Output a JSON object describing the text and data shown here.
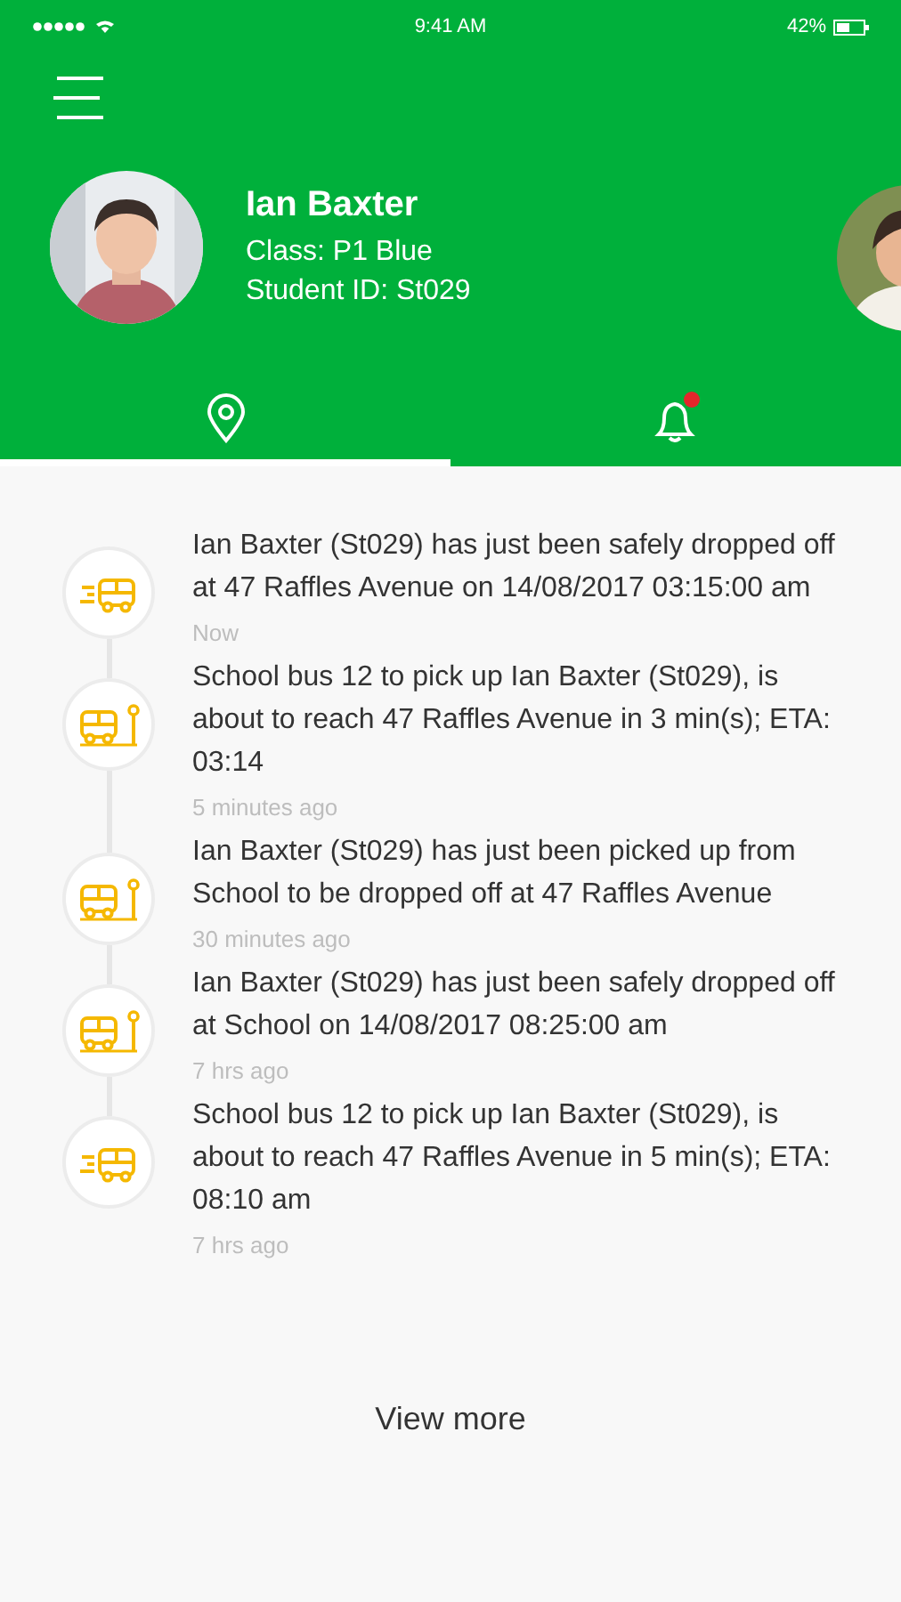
{
  "status_bar": {
    "time": "9:41 AM",
    "battery": "42%"
  },
  "student": {
    "name": "Ian Baxter",
    "class": "Class: P1 Blue",
    "student_id": "Student ID: St029"
  },
  "tabs": [
    {
      "selected": true,
      "alert": false
    },
    {
      "selected": false,
      "alert": true
    }
  ],
  "events": [
    {
      "kind": "moving",
      "message": "Ian Baxter (St029) has just been safely dropped off at 47 Raffles Avenue on 14/08/2017 03:15:00 am",
      "time": "Now"
    },
    {
      "kind": "stop",
      "message": "School bus 12 to pick up Ian Baxter (St029), is about to reach 47 Raffles Avenue in 3 min(s); ETA: 03:14",
      "time": "5 minutes ago"
    },
    {
      "kind": "stop",
      "message": "Ian Baxter (St029) has just been picked up from School to be dropped off at 47 Raffles Avenue",
      "time": "30 minutes ago"
    },
    {
      "kind": "stop",
      "message": "Ian Baxter (St029) has just been safely dropped off at School on 14/08/2017 08:25:00 am",
      "time": "7 hrs ago"
    },
    {
      "kind": "moving",
      "message": "School bus 12 to pick up Ian Baxter (St029), is about to reach 47 Raffles Avenue in 5 min(s); ETA: 08:10 am",
      "time": "7 hrs ago"
    }
  ],
  "view_more": "View more"
}
